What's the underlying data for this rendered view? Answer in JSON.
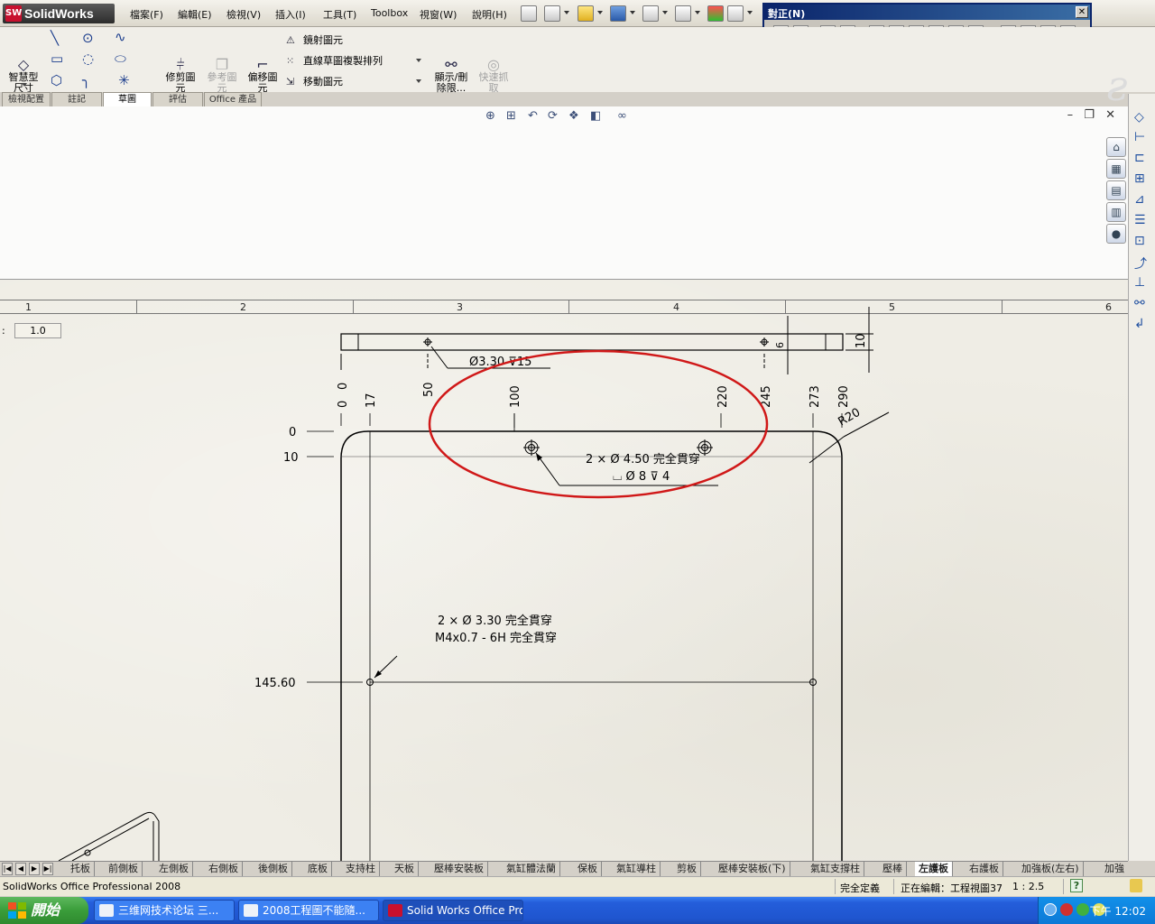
{
  "menubar": {
    "app_name": "SolidWorks",
    "items": [
      "檔案(F)",
      "編輯(E)",
      "檢視(V)",
      "插入(I)",
      "工具(T)",
      "Toolbox",
      "視窗(W)",
      "說明(H)"
    ]
  },
  "align_toolbar": {
    "title": "對正(N)",
    "close": "✕"
  },
  "command_manager": {
    "smart_dim": "智慧型\n尺寸",
    "trim": "修剪圖\n元",
    "convert": "參考圖\n元",
    "offset": "偏移圖\n元",
    "mirror": "鏡射圖元",
    "linear_pattern": "直線草圖複製排列",
    "move": "移動圖元",
    "display_delete": "顯示/刪\n除限...",
    "quick_snaps": "快速抓\n取",
    "tabs": [
      "檢視配置",
      "註記",
      "草圖",
      "評估",
      "Office 產品"
    ],
    "active_tab": "草圖"
  },
  "sheet": {
    "scale_label": ":",
    "scale_value": "1.0",
    "zones": [
      "1",
      "2",
      "3",
      "4",
      "5",
      "6"
    ]
  },
  "drawing": {
    "callout_top": "Ø3.30 ⊽15",
    "dims_top": [
      "0",
      "0",
      "17",
      "50",
      "100",
      "220",
      "245",
      "273",
      "290"
    ],
    "dim_side_6": "6",
    "dim_side_10": "10",
    "radius": "R20",
    "dims_left": [
      "0",
      "10",
      "145.60"
    ],
    "hole_callout_1_line1": "2 × Ø 4.50 完全貫穿",
    "hole_callout_1_line2": "⌴ Ø 8 ⊽ 4",
    "hole_callout_2_line1": "2 × Ø 3.30 完全貫穿",
    "hole_callout_2_line2": "M4x0.7 - 6H 完全貫穿"
  },
  "sheet_tabs": {
    "items": [
      "托板",
      "前側板",
      "左側板",
      "右側板",
      "後側板",
      "底板",
      "支持柱",
      "天板",
      "壓棒安裝板",
      "氣缸體法蘭",
      "保板",
      "氣缸導柱",
      "剪板",
      "壓棒安裝板(下)",
      "氣缸支撐柱",
      "壓棒",
      "左護板",
      "右護板",
      "加強板(左右)",
      "加強"
    ],
    "active": "左護板"
  },
  "status": {
    "product": "SolidWorks Office Professional 2008",
    "state": "完全定義",
    "editing": "正在編輯：工程視圖37",
    "scale": "1 : 2.5",
    "help": "?"
  },
  "taskbar": {
    "start": "開始",
    "tasks": [
      "三维网技术论坛 三...",
      "2008工程圖不能隨...",
      "Solid Works Office Pro..."
    ],
    "clock": "下午 12:02"
  },
  "colors": {
    "highlight_ellipse": "#d01818",
    "sheet_bg": "#efede5",
    "taskbar": "#245edb",
    "accent_title": "#0a246a"
  }
}
